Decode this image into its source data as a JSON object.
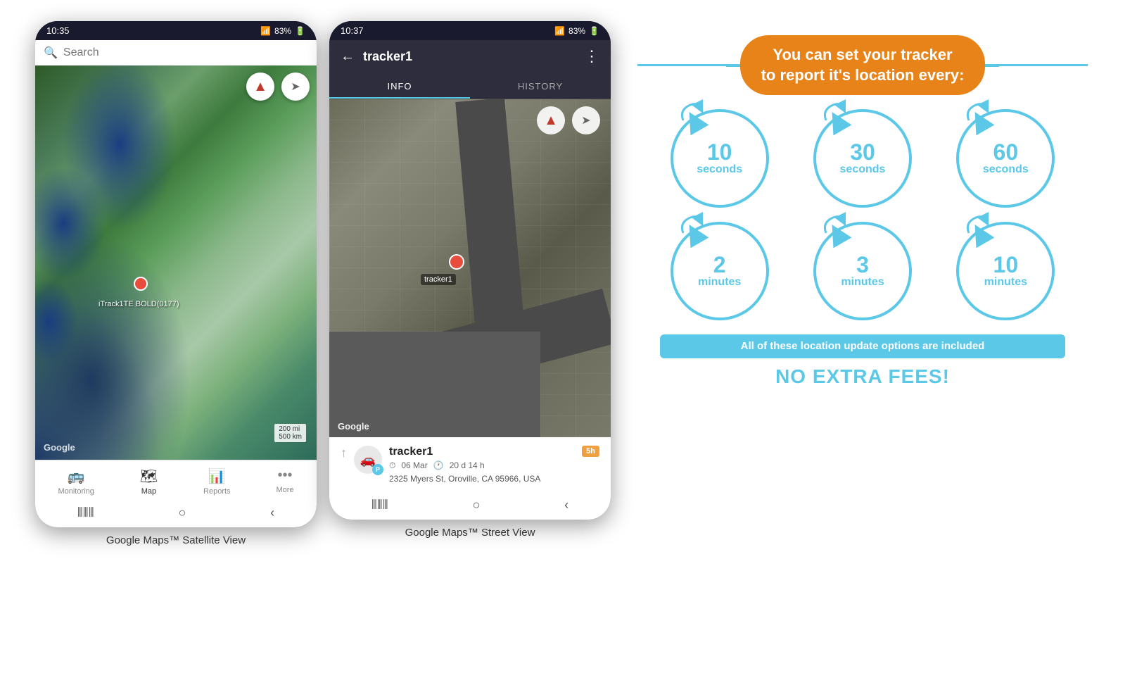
{
  "phone1": {
    "status_bar": {
      "time": "10:35",
      "signal": "▲▲▲",
      "battery": "83%"
    },
    "search_placeholder": "Search",
    "compass_icon": "▲",
    "nav_icon": "➤",
    "marker_label": "iTrack1TE BOLD(0177)",
    "google_label": "Google",
    "scale_label": "200 mi\n500 km",
    "nav_items": [
      {
        "icon": "🚌",
        "label": "Monitoring",
        "active": false
      },
      {
        "icon": "🗺",
        "label": "Map",
        "active": true
      },
      {
        "icon": "📊",
        "label": "Reports",
        "active": false
      },
      {
        "icon": "•••",
        "label": "More",
        "active": false
      }
    ],
    "caption": "Google Maps™ Satellite View"
  },
  "phone2": {
    "status_bar": {
      "time": "10:37",
      "signal": "▲▲▲",
      "battery": "83%"
    },
    "header": {
      "title": "tracker1",
      "back_label": "←",
      "more_label": "⋮"
    },
    "tabs": [
      {
        "label": "INFO",
        "active": true
      },
      {
        "label": "HISTORY",
        "active": false
      }
    ],
    "compass_icon": "▲",
    "nav_icon": "➤",
    "aerial_label": "tracker1",
    "google_label": "Google",
    "tracker_info": {
      "name": "tracker1",
      "date": "06 Mar",
      "duration": "20 d 14 h",
      "address": "2325 Myers St, Oroville, CA 95966, USA",
      "badge": "5h"
    },
    "caption": "Google Maps™ Street View"
  },
  "info_panel": {
    "title_line1": "You can set your tracker",
    "title_line2": "to report it's location every:",
    "circles": [
      {
        "number": "10",
        "unit": "seconds"
      },
      {
        "number": "30",
        "unit": "seconds"
      },
      {
        "number": "60",
        "unit": "seconds"
      },
      {
        "number": "2",
        "unit": "minutes"
      },
      {
        "number": "3",
        "unit": "minutes"
      },
      {
        "number": "10",
        "unit": "minutes"
      }
    ],
    "bottom_badge": "All of these location update options are included",
    "no_extra_fees": "NO EXTRA FEES!"
  }
}
